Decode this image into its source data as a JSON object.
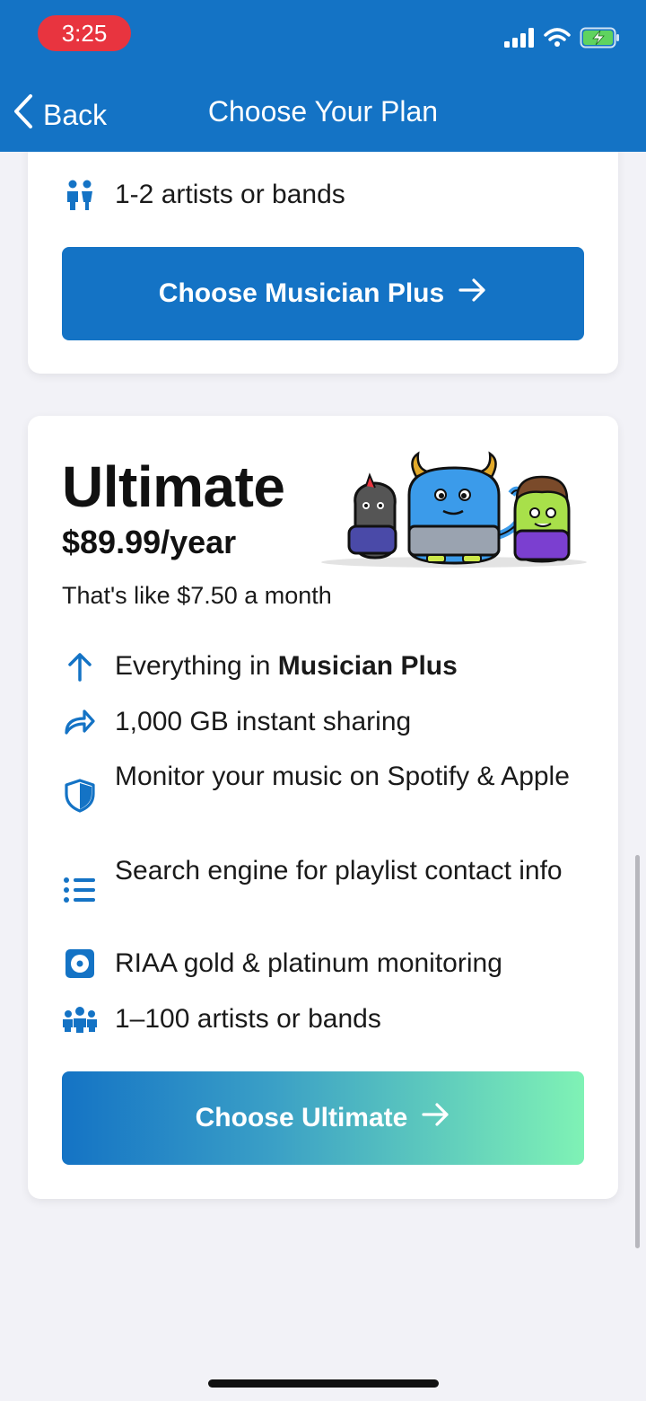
{
  "status_bar": {
    "time": "3:25"
  },
  "nav": {
    "back_label": "Back",
    "title": "Choose Your Plan"
  },
  "musician_plus": {
    "partial_feature": "1-2 artists or bands",
    "cta_label": "Choose Musician Plus"
  },
  "ultimate": {
    "name": "Ultimate",
    "price": "$89.99/year",
    "monthly_note": "That's like $7.50 a month",
    "features": [
      {
        "icon": "arrow-up-icon",
        "prefix": "Everything in ",
        "bold": "Musician Plus"
      },
      {
        "icon": "share-icon",
        "text": "1,000 GB instant sharing"
      },
      {
        "icon": "shield-icon",
        "text": "Monitor your music on Spotify & Apple"
      },
      {
        "icon": "list-icon",
        "text": "Search engine for playlist contact info"
      },
      {
        "icon": "record-icon",
        "text": "RIAA gold & platinum monitoring"
      },
      {
        "icon": "group-icon",
        "text": "1–100 artists or bands"
      }
    ],
    "cta_label": "Choose Ultimate"
  },
  "colors": {
    "brand_blue": "#1473c5",
    "status_red": "#e8343f",
    "gradient_end": "#7ff2b5",
    "background": "#f2f2f7"
  }
}
